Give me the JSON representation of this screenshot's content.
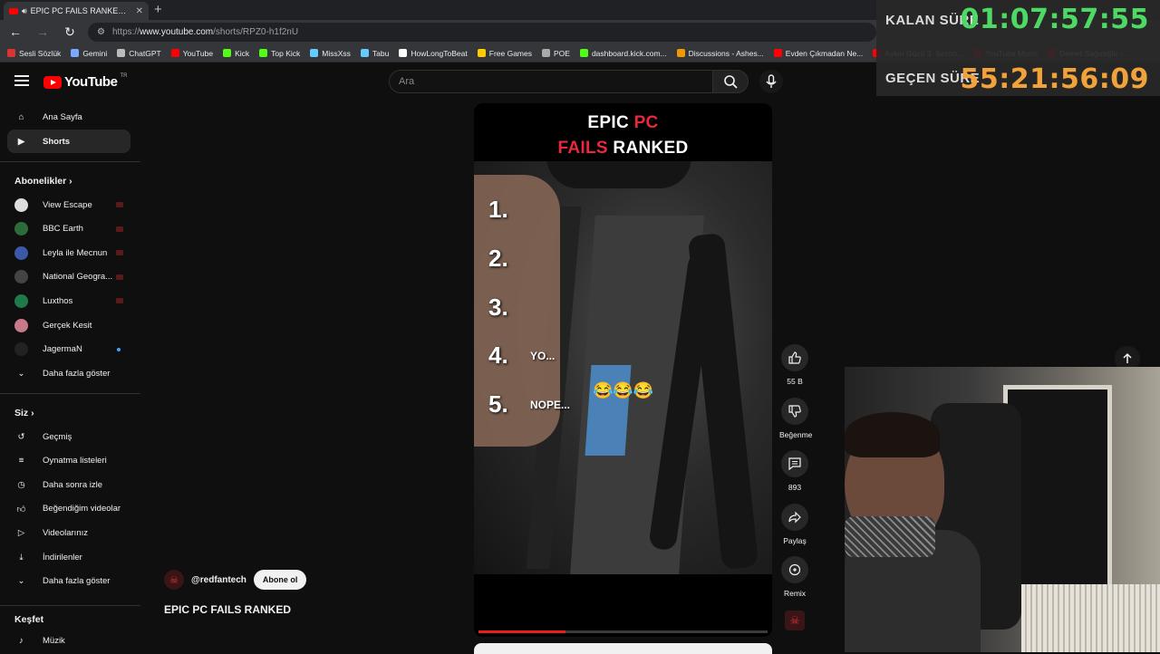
{
  "browser": {
    "tab_title": "EPIC PC FAILS RANKED - You",
    "url_prefix": "https://",
    "url_domain": "www.youtube.com",
    "url_path": "/shorts/RPZ0-h1f2nU",
    "bookmarks": [
      {
        "label": "Sesli Sözlük",
        "color": "#d33"
      },
      {
        "label": "Gemini",
        "color": "#7aa7ff"
      },
      {
        "label": "ChatGPT",
        "color": "#bbb"
      },
      {
        "label": "YouTube",
        "color": "#f00"
      },
      {
        "label": "Kick",
        "color": "#53fc18"
      },
      {
        "label": "Top Kick",
        "color": "#53fc18"
      },
      {
        "label": "MissXss",
        "color": "#6cf"
      },
      {
        "label": "Tabu",
        "color": "#6cf"
      },
      {
        "label": "HowLongToBeat",
        "color": "#fff"
      },
      {
        "label": "Free Games",
        "color": "#fc0"
      },
      {
        "label": "POE",
        "color": "#aaa"
      },
      {
        "label": "dashboard.kick.com...",
        "color": "#53fc18"
      },
      {
        "label": "Discussions - Ashes...",
        "color": "#e90"
      },
      {
        "label": "Evden Çıkmadan Ne...",
        "color": "#f00"
      },
      {
        "label": "Aşkın Gücü 3. Sezon...",
        "color": "#f00"
      },
      {
        "label": "YouTube Music",
        "color": "#f00"
      },
      {
        "label": "Demet Sağıroğlu -...",
        "color": "#f00"
      }
    ]
  },
  "masthead": {
    "logo_text": "YouTube",
    "logo_country": "TR",
    "search_placeholder": "Ara"
  },
  "sidebar": {
    "main": [
      {
        "label": "Ana Sayfa",
        "icon": "home-icon"
      },
      {
        "label": "Shorts",
        "icon": "shorts-icon",
        "active": true
      }
    ],
    "subscriptions_heading": "Abonelikler",
    "subscriptions": [
      {
        "label": "View Escape",
        "color": "#ddd",
        "live": true
      },
      {
        "label": "BBC Earth",
        "color": "#2e6b3a",
        "live": true
      },
      {
        "label": "Leyla ile Mecnun",
        "color": "#3a5aa8",
        "live": true
      },
      {
        "label": "National Geogra...",
        "color": "#444",
        "live": true
      },
      {
        "label": "Luxthos",
        "color": "#1f7a4a",
        "live": true
      },
      {
        "label": "Gerçek Kesit",
        "color": "#c8798a",
        "live": false
      },
      {
        "label": "JagermaN",
        "color": "#222",
        "dot": true
      }
    ],
    "subs_more": "Daha fazla göster",
    "you_heading": "Siz",
    "you": [
      {
        "label": "Geçmiş",
        "icon": "history-icon"
      },
      {
        "label": "Oynatma listeleri",
        "icon": "playlist-icon"
      },
      {
        "label": "Daha sonra izle",
        "icon": "clock-icon"
      },
      {
        "label": "Beğendiğim videolar",
        "icon": "like-icon"
      },
      {
        "label": "Videolarınız",
        "icon": "video-icon"
      },
      {
        "label": "İndirilenler",
        "icon": "download-icon"
      },
      {
        "label": "Daha fazla göster",
        "icon": "chevron-down-icon"
      }
    ],
    "explore_heading": "Keşfet",
    "explore": [
      {
        "label": "Müzik",
        "icon": "music-icon"
      }
    ]
  },
  "short": {
    "title_word1": "EPIC",
    "title_word2": "PC",
    "title_word3": "FAILS",
    "title_word4": "RANKED",
    "ranks": [
      "1.",
      "2.",
      "3.",
      "4.",
      "5."
    ],
    "note_4": "YO...",
    "note_5": "NOPE...",
    "emoji": "😂😂😂",
    "progress": 0.3
  },
  "actions": {
    "likes": "55 B",
    "dislike_label": "Beğenme",
    "comments": "893",
    "share_label": "Paylaş",
    "remix_label": "Remix"
  },
  "channel": {
    "handle": "@redfantech",
    "subscribe_label": "Abone ol",
    "video_title": "EPIC PC FAILS RANKED"
  },
  "overlay": {
    "remaining_label": "KALAN SÜRE",
    "remaining_value": "01:07:57:55",
    "remaining_color": "#4cd964",
    "elapsed_label": "GEÇEN SÜRE",
    "elapsed_value": "55:21:56:09",
    "elapsed_color": "#f2a23a"
  }
}
